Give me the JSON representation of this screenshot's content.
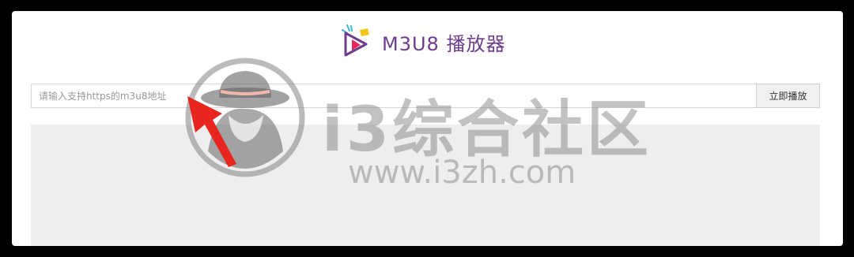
{
  "app": {
    "title": "M3U8 播放器",
    "logo_icon": "play-logo-icon",
    "accent_color": "#6e3c8c"
  },
  "url_bar": {
    "placeholder": "请输入支持https的m3u8地址",
    "value": "",
    "play_label": "立即播放"
  },
  "watermark": {
    "name": "i3综合社区",
    "url": "www.i3zh.com",
    "mascot_icon": "hat-mascot-icon"
  },
  "annotation": {
    "arrow_icon": "red-arrow-icon",
    "color": "#e8261f"
  }
}
